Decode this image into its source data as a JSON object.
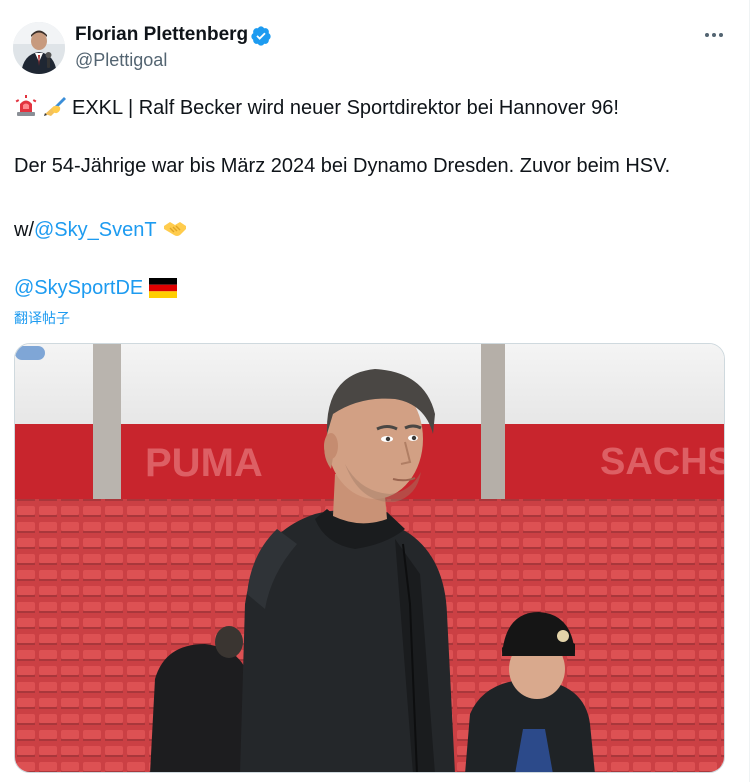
{
  "author": {
    "name": "Florian Plettenberg",
    "handle": "@Plettigoal",
    "avatar_icon": "person-avatar",
    "verified_icon": "verified-badge-icon",
    "verified_color": "#1d9bf0"
  },
  "menu": {
    "icon": "more-options-icon"
  },
  "tweet": {
    "line1_text": "EXKL | Ralf Becker wird neuer Sportdirektor bei Hannover 96!",
    "line1_icons": [
      "siren-icon",
      "writing-hand-icon"
    ],
    "line2_text": "Der 54-Jährige war bis März 2024 bei Dynamo Dresden. Zuvor beim HSV.",
    "line3_prefix": "w/",
    "line3_mention": "@Sky_SvenT",
    "line3_icon": "handshake-icon",
    "line4_mention": "@SkySportDE",
    "line4_icon": "german-flag-icon",
    "translate_label": "翻译帖子"
  },
  "media": {
    "icon": "photo-stadium-man",
    "banner_left": "PUMA",
    "banner_right": "SACHS",
    "accent_color": "#c8252d"
  },
  "colors": {
    "text": "#0f1419",
    "secondary": "#536471",
    "link": "#1d9bf0"
  }
}
